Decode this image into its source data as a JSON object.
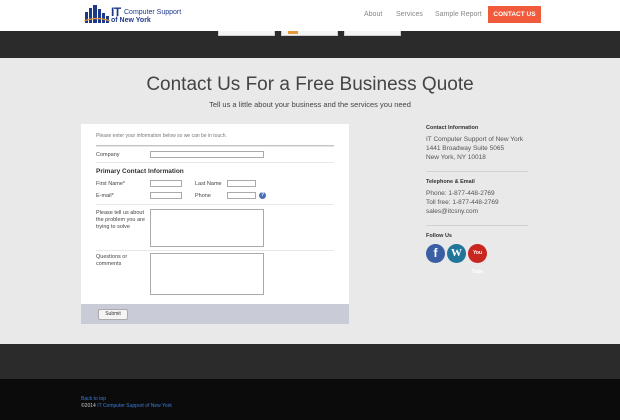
{
  "header": {
    "logo_it": "IT",
    "logo_line1": "Computer Support",
    "logo_line2": "of New York",
    "nav": [
      "About",
      "Services",
      "Sample Report"
    ],
    "contact_button": "CONTACT US",
    "colors": {
      "accent": "#f15a3a",
      "brand": "#1d3a8a"
    }
  },
  "hero": {
    "title": "Contact Us For a Free Business Quote",
    "subtitle": "Tell us a little about your business and the services you need"
  },
  "form": {
    "intro": "Please enter your information below so we can be in touch.",
    "company_label": "Company",
    "section_title": "Primary Contact Information",
    "first_name_label": "First Name*",
    "last_name_label": "Last Name",
    "email_label": "E-mail*",
    "phone_label": "Phone",
    "help_icon": "?",
    "problem_label": "Please tell us about the problem you are trying to solve",
    "questions_label": "Questions or comments",
    "submit_label": "Submit"
  },
  "sidebar": {
    "contact_heading": "Contact Information",
    "contact_lines": [
      "IT Computer Support of New York",
      "1441 Broadway Suite 5065",
      "New York, NY 10018"
    ],
    "telephone_heading": "Telephone & Email",
    "telephone_lines": [
      "Phone: 1-877-448-2769",
      "Toll free: 1-877-448-2769",
      "sales@itcsny.com"
    ],
    "follow_heading": "Follow Us",
    "social_icons": [
      "facebook-icon",
      "wordpress-icon",
      "youtube-icon"
    ],
    "facebook_glyph": "f",
    "wordpress_glyph": "W",
    "youtube_glyph": "You Tube"
  },
  "footer": {
    "back_to_top": "Back to top",
    "copyright_prefix": "©2014 ",
    "copyright_link": "IT Computer Support of New York"
  }
}
